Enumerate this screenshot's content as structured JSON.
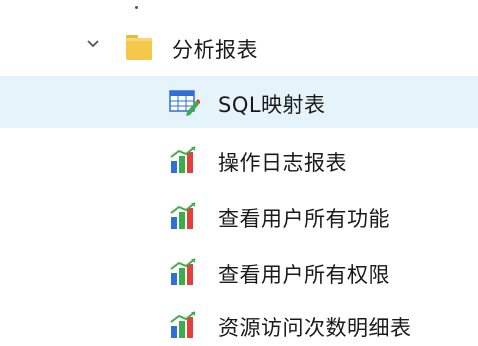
{
  "tree": {
    "folder": {
      "label": "分析报表",
      "expanded": true,
      "icon": "folder-icon"
    },
    "items": [
      {
        "label": "SQL映射表",
        "icon": "table-edit-icon",
        "selected": true
      },
      {
        "label": "操作日志报表",
        "icon": "bar-chart-icon",
        "selected": false
      },
      {
        "label": "查看用户所有功能",
        "icon": "bar-chart-icon",
        "selected": false
      },
      {
        "label": "查看用户所有权限",
        "icon": "bar-chart-icon",
        "selected": false
      },
      {
        "label": "资源访问次数明细表",
        "icon": "bar-chart-icon",
        "selected": false
      }
    ]
  },
  "colors": {
    "selected_row": "#e5f3fb",
    "folder": "#f5c84c",
    "chart_blue": "#2f6fd6",
    "chart_green": "#3cae49",
    "chart_red": "#e2403a"
  }
}
